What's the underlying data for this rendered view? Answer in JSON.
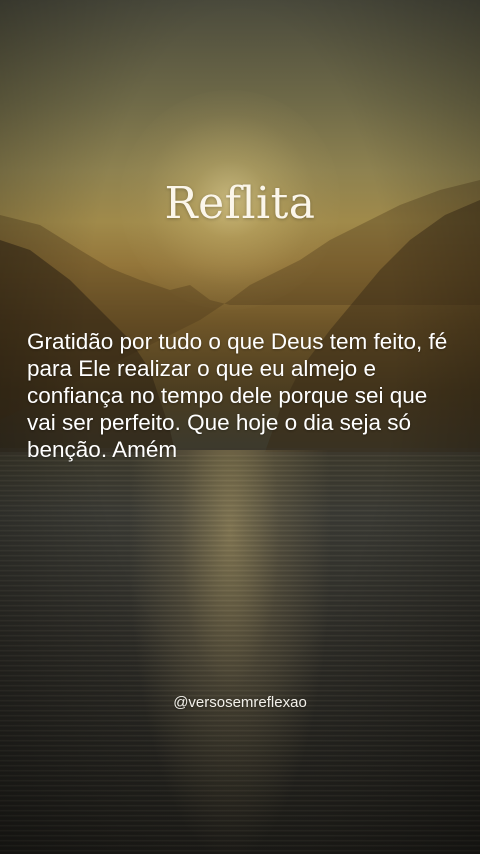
{
  "title": "Reflita",
  "message": "Gratidão por tudo o que Deus tem feito, fé para Ele realizar o que eu almejo e confiança no tempo dele porque sei que vai ser perfeito. Que hoje o dia seja só benção. Amém",
  "handle": "@versosemreflexao",
  "colors": {
    "sky_top": "#4a4a3c",
    "sun_glow": "#ebdca0",
    "water": "#2d2c27",
    "text": "#ffffff"
  }
}
